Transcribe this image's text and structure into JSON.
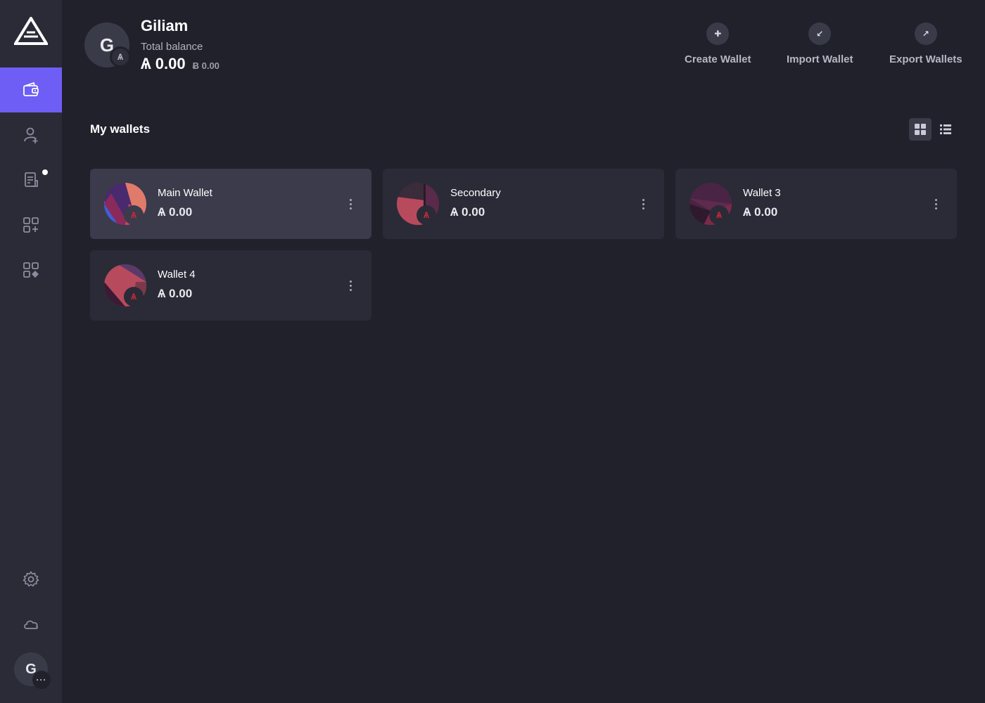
{
  "sidebar": {
    "logo_icon": "ark-logo-icon",
    "items": [
      {
        "name": "wallets",
        "icon": "wallet-icon",
        "active": true
      },
      {
        "name": "contacts",
        "icon": "add-contact-icon",
        "active": false
      },
      {
        "name": "announcements",
        "icon": "document-icon",
        "active": false,
        "notification": true
      },
      {
        "name": "plugins",
        "icon": "add-plugin-icon",
        "active": false
      },
      {
        "name": "plugin-manager",
        "icon": "apps-icon",
        "active": false
      }
    ],
    "settings_icon": "gear-icon",
    "network_icon": "cloud-icon",
    "profile_initial": "G",
    "profile_more": "···"
  },
  "header": {
    "avatar_initial": "G",
    "network_symbol": "Ѧ",
    "name": "Giliam",
    "balance_label": "Total balance",
    "balance": "Ѧ 0.00",
    "balance_alt": "Ƀ 0.00",
    "actions": [
      {
        "label": "Create Wallet",
        "icon": "plus-icon",
        "glyph": "✚"
      },
      {
        "label": "Import Wallet",
        "icon": "import-icon",
        "glyph": "↙"
      },
      {
        "label": "Export Wallets",
        "icon": "export-icon",
        "glyph": "↗"
      }
    ]
  },
  "main": {
    "section_title": "My wallets",
    "view": "grid",
    "wallets": [
      {
        "name": "Main Wallet",
        "balance": "Ѧ 0.00",
        "selected": true,
        "badge": "Ѧ"
      },
      {
        "name": "Secondary",
        "balance": "Ѧ 0.00",
        "selected": false,
        "badge": "Ѧ"
      },
      {
        "name": "Wallet 3",
        "balance": "Ѧ 0.00",
        "selected": false,
        "badge": "Ѧ"
      },
      {
        "name": "Wallet 4",
        "balance": "Ѧ 0.00",
        "selected": false,
        "badge": "Ѧ"
      }
    ]
  },
  "colors": {
    "background": "#20212b",
    "sidebar": "#2a2b36",
    "accent": "#6e5ef5",
    "card": "#2a2b36",
    "card_selected": "#3b3b4b",
    "network_badge": "#d0263a"
  }
}
